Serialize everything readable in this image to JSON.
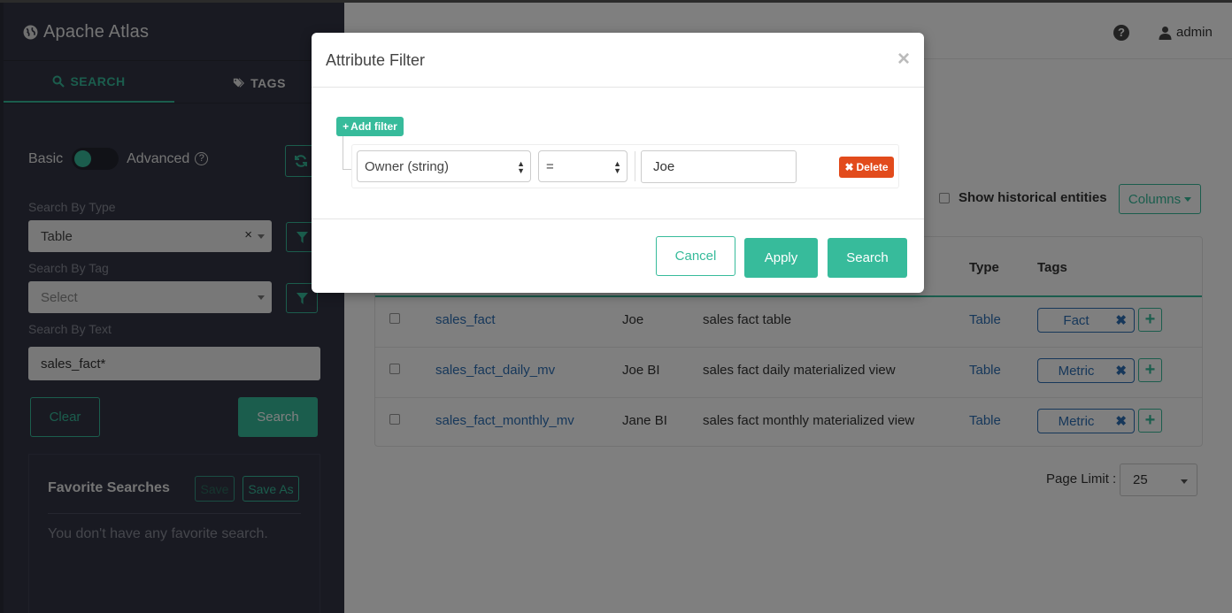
{
  "app": {
    "title": "Apache Atlas",
    "user": "admin"
  },
  "sidebar": {
    "tabs": [
      {
        "label": "SEARCH",
        "active": true
      },
      {
        "label": "TAGS",
        "active": false
      }
    ],
    "toggle": {
      "left_label": "Basic",
      "right_label": "Advanced",
      "state": "Basic"
    },
    "search_by_type": {
      "label": "Search By Type",
      "value": "Table"
    },
    "search_by_tag": {
      "label": "Search By Tag",
      "placeholder": "Select"
    },
    "search_by_text": {
      "label": "Search By Text",
      "value": "sales_fact*"
    },
    "clear_label": "Clear",
    "search_label": "Search",
    "favorites": {
      "title": "Favorite Searches",
      "save_label": "Save",
      "save_as_label": "Save As",
      "empty_text": "You don't have any favorite search."
    }
  },
  "main": {
    "show_historical_label": "Show historical entities",
    "columns_label": "Columns",
    "table": {
      "headers": {
        "type": "Type",
        "tags": "Tags"
      },
      "rows": [
        {
          "name": "sales_fact",
          "owner": "Joe",
          "description": "sales fact table",
          "type": "Table",
          "tag": "Fact"
        },
        {
          "name": "sales_fact_daily_mv",
          "owner": "Joe BI",
          "description": "sales fact daily materialized view",
          "type": "Table",
          "tag": "Metric"
        },
        {
          "name": "sales_fact_monthly_mv",
          "owner": "Jane BI",
          "description": "sales fact monthly materialized view",
          "type": "Table",
          "tag": "Metric"
        }
      ]
    },
    "page_limit": {
      "label": "Page Limit :",
      "value": "25"
    }
  },
  "modal": {
    "title": "Attribute Filter",
    "close_symbol": "×",
    "add_filter_label": "Add filter",
    "rule": {
      "attribute": "Owner (string)",
      "operator": "=",
      "value": "Joe",
      "delete_label": "Delete"
    },
    "cancel_label": "Cancel",
    "apply_label": "Apply",
    "search_label": "Search"
  },
  "colors": {
    "accent": "#37bb9b",
    "sidebar_bg": "#323544",
    "link": "#2d6fb5",
    "danger": "#e24b1c"
  },
  "icons": [
    "globe-icon",
    "search-icon",
    "tags-icon",
    "help-icon",
    "refresh-icon",
    "filter-icon",
    "user-icon",
    "close-icon",
    "plus-icon",
    "remove-icon"
  ]
}
